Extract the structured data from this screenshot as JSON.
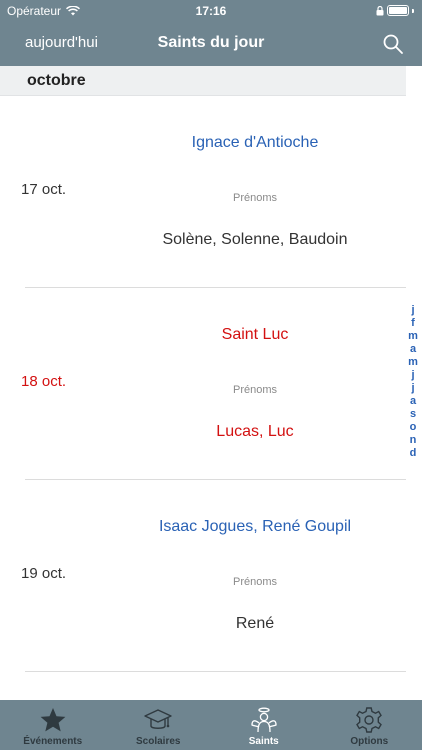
{
  "status_bar": {
    "carrier": "Opérateur",
    "time": "17:16"
  },
  "nav": {
    "left_button": "aujourd'hui",
    "title": "Saints du jour"
  },
  "section": {
    "label": "octobre"
  },
  "rows": [
    {
      "date": "17 oct.",
      "saint": "Ignace d'Antioche",
      "prenoms_label": "Prénoms",
      "prenoms": "Solène, Solenne, Baudoin",
      "highlighted": false
    },
    {
      "date": "18 oct.",
      "saint": "Saint Luc",
      "prenoms_label": "Prénoms",
      "prenoms": "Lucas, Luc",
      "highlighted": true
    },
    {
      "date": "19 oct.",
      "saint": "Isaac Jogues, René Goupil",
      "prenoms_label": "Prénoms",
      "prenoms": "René",
      "highlighted": false
    }
  ],
  "month_index": [
    "j",
    "f",
    "m",
    "a",
    "m",
    "j",
    "j",
    "a",
    "s",
    "o",
    "n",
    "d"
  ],
  "tabs": [
    {
      "label": "Événements",
      "icon": "star-icon",
      "active": false
    },
    {
      "label": "Scolaires",
      "icon": "graduation-cap-icon",
      "active": false
    },
    {
      "label": "Saints",
      "icon": "angel-icon",
      "active": true
    },
    {
      "label": "Options",
      "icon": "gear-icon",
      "active": false
    }
  ],
  "colors": {
    "bar": "#6f8590",
    "link_blue": "#2a62b5",
    "today_red": "#d31111",
    "battery_level": 1.0
  }
}
